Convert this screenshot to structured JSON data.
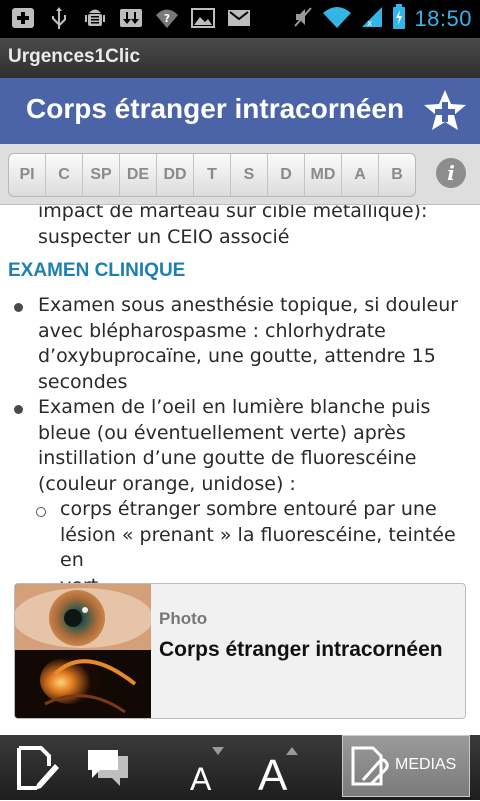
{
  "status_bar": {
    "time": "18:50",
    "icons_left": [
      "add-icon",
      "usb-icon",
      "android-debug-icon",
      "download-icon",
      "wifi-question-icon",
      "image-icon",
      "gmail-icon"
    ],
    "icons_right": [
      "mute-icon",
      "wifi-icon",
      "signal-icon",
      "battery-charging-icon"
    ]
  },
  "app": {
    "name": "Urgences1Clic"
  },
  "header": {
    "title": "Corps étranger intracornéen",
    "favorite_icon": "add-favorite-star-icon"
  },
  "tabs": [
    "PI",
    "C",
    "SP",
    "DE",
    "DD",
    "T",
    "S",
    "D",
    "MD",
    "A",
    "B"
  ],
  "info_icon": "info-icon",
  "content": {
    "continued_lines": [
      "impact de marteau sur cible métallique):",
      "suspecter un CEIO associé"
    ],
    "section_title": "EXAMEN CLINIQUE",
    "bullets": [
      {
        "lines": [
          "Examen sous anesthésie topique, si douleur",
          "avec blépharospasme : chlorhydrate",
          "d’oxybuprocaïne, une goutte, attendre 15",
          "secondes"
        ]
      },
      {
        "lines": [
          "Examen de l’oeil en lumière blanche puis",
          "bleue (ou éventuellement verte) après",
          "instillation d’une goutte de fluorescéine",
          "(couleur orange, unidose) :"
        ]
      }
    ],
    "sub_bullet_lines": [
      "corps étranger sombre entouré par une",
      "lésion « prenant » la fluorescéine, teintée en",
      "vert"
    ]
  },
  "media_card": {
    "type": "Photo",
    "title": "Corps étranger intracornéen"
  },
  "bottom_bar": {
    "edit_icon": "note-edit-icon",
    "comment_icon": "comments-icon",
    "font_decrease_label": "A",
    "font_increase_label": "A",
    "medias_label": "MEDIAS",
    "medias_icon": "attachment-document-icon"
  },
  "colors": {
    "title_bar": "#4b64a8",
    "section_title": "#1f7fb3",
    "clock": "#33b5e5"
  }
}
